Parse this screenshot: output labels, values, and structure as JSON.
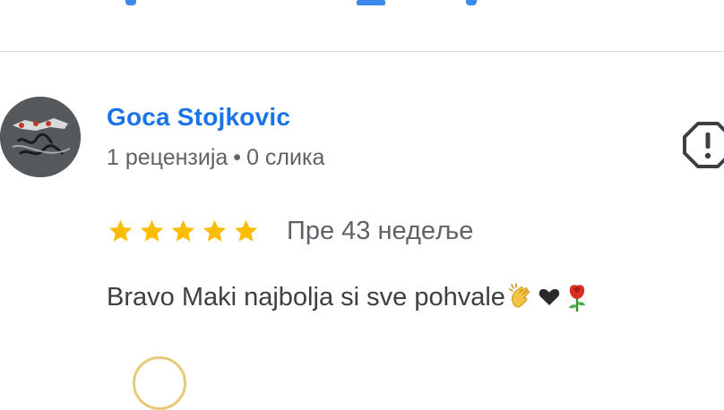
{
  "review": {
    "reviewer": {
      "name": "Goca Stojkovic",
      "review_count": "1 рецензија",
      "separator": "•",
      "photo_count": "0 слика",
      "avatar_icon": "avatar-image"
    },
    "rating": 5,
    "date": "Пре 43 недеље",
    "text": "Bravo Maki najbolja si sve pohvale",
    "emojis": [
      "clapping-hands-emoji",
      "heart-emoji",
      "rose-emoji"
    ],
    "actions": {
      "report_icon": "report-icon"
    }
  },
  "colors": {
    "name": "#1a73e8",
    "star": "#fbbc04",
    "meta": "#5f6368",
    "text": "#3c4043",
    "divider": "#dadce0"
  }
}
